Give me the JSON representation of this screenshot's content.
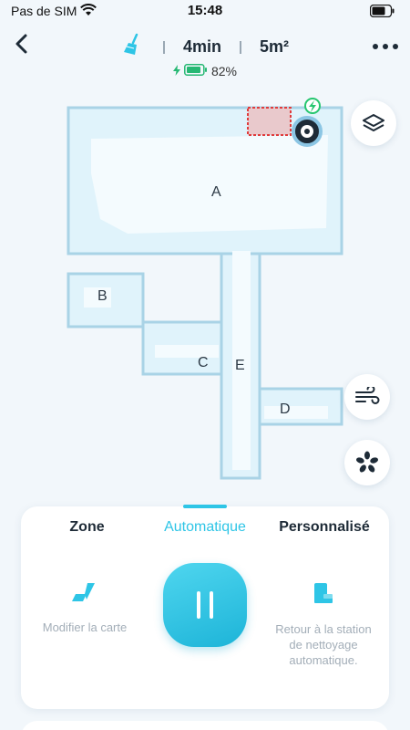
{
  "status_bar": {
    "carrier": "Pas de SIM",
    "time": "15:48"
  },
  "header": {
    "duration": "4min",
    "area": "5m²",
    "battery_percent": "82%"
  },
  "map": {
    "rooms": [
      "A",
      "B",
      "C",
      "D",
      "E"
    ]
  },
  "panel": {
    "tabs": [
      {
        "label": "Zone"
      },
      {
        "label": "Automatique"
      },
      {
        "label": "Personnalisé"
      }
    ],
    "active_tab": "Automatique",
    "actions": {
      "edit_map": "Modifier la carte",
      "return_dock": "Retour à la station de nettoyage automatique."
    }
  },
  "colors": {
    "accent": "#2ec5e6",
    "map_fill": "#e0f3fb",
    "map_wall": "#a9d3e6"
  }
}
